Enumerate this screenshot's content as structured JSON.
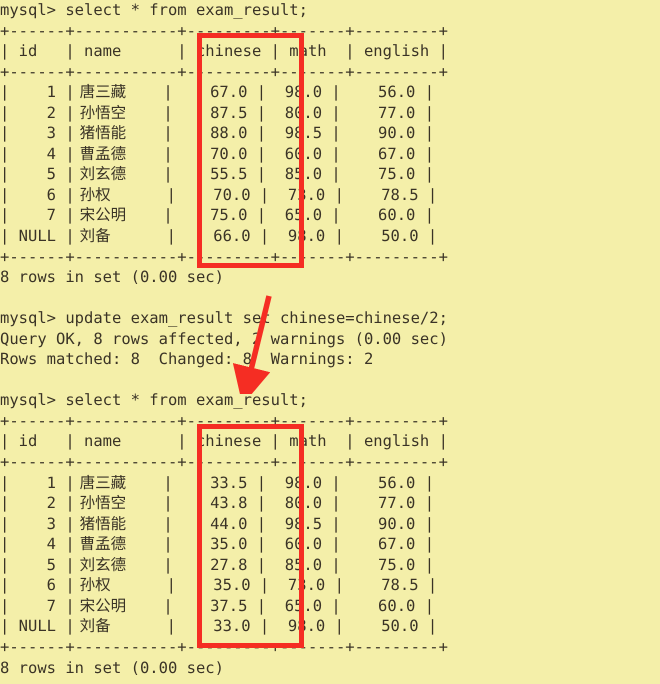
{
  "terminal": {
    "background_color": "#f4efa9",
    "text_color": "#3a3326",
    "annotation_color": "#f52d23",
    "prompt": "mysql>"
  },
  "commands": {
    "select_1": "mysql> select * from exam_result;",
    "update": "mysql> update exam_result set chinese=chinese/2;",
    "update_result_1": "Query OK, 8 rows affected, 2 warnings (0.00 sec)",
    "update_result_2": "Rows matched: 8  Changed: 8  Warnings: 2",
    "select_2": "mysql> select * from exam_result;",
    "rows_in_set_1": "8 rows in set (0.00 sec)",
    "rows_in_set_2": "8 rows in set (0.00 sec)"
  },
  "table": {
    "separator": "+------+-----------+---------+-------+---------+",
    "header_row": "| id   | name      | chinese | math  | english |",
    "columns": [
      "id",
      "name",
      "chinese",
      "math",
      "english"
    ]
  },
  "table_before": {
    "rows": [
      {
        "id": "1",
        "name": "唐三藏",
        "chinese": "67.0",
        "math": "98.0",
        "english": "56.0"
      },
      {
        "id": "2",
        "name": "孙悟空",
        "chinese": "87.5",
        "math": "80.0",
        "english": "77.0"
      },
      {
        "id": "3",
        "name": "猪悟能",
        "chinese": "88.0",
        "math": "98.5",
        "english": "90.0"
      },
      {
        "id": "4",
        "name": "曹孟德",
        "chinese": "70.0",
        "math": "60.0",
        "english": "67.0"
      },
      {
        "id": "5",
        "name": "刘玄德",
        "chinese": "55.5",
        "math": "85.0",
        "english": "75.0"
      },
      {
        "id": "6",
        "name": "孙权",
        "chinese": "70.0",
        "math": "73.0",
        "english": "78.5"
      },
      {
        "id": "7",
        "name": "宋公明",
        "chinese": "75.0",
        "math": "65.0",
        "english": "60.0"
      },
      {
        "id": "NULL",
        "name": "刘备",
        "chinese": "66.0",
        "math": "98.0",
        "english": "50.0"
      }
    ]
  },
  "table_after": {
    "rows": [
      {
        "id": "1",
        "name": "唐三藏",
        "chinese": "33.5",
        "math": "98.0",
        "english": "56.0"
      },
      {
        "id": "2",
        "name": "孙悟空",
        "chinese": "43.8",
        "math": "80.0",
        "english": "77.0"
      },
      {
        "id": "3",
        "name": "猪悟能",
        "chinese": "44.0",
        "math": "98.5",
        "english": "90.0"
      },
      {
        "id": "4",
        "name": "曹孟德",
        "chinese": "35.0",
        "math": "60.0",
        "english": "67.0"
      },
      {
        "id": "5",
        "name": "刘玄德",
        "chinese": "27.8",
        "math": "85.0",
        "english": "75.0"
      },
      {
        "id": "6",
        "name": "孙权",
        "chinese": "35.0",
        "math": "73.0",
        "english": "78.5"
      },
      {
        "id": "7",
        "name": "宋公明",
        "chinese": "37.5",
        "math": "65.0",
        "english": "60.0"
      },
      {
        "id": "NULL",
        "name": "刘备",
        "chinese": "33.0",
        "math": "98.0",
        "english": "50.0"
      }
    ]
  },
  "annotations": {
    "box_top_label": "chinese-column-before-highlight",
    "box_bottom_label": "chinese-column-after-highlight",
    "arrow_label": "update-effect-arrow"
  }
}
